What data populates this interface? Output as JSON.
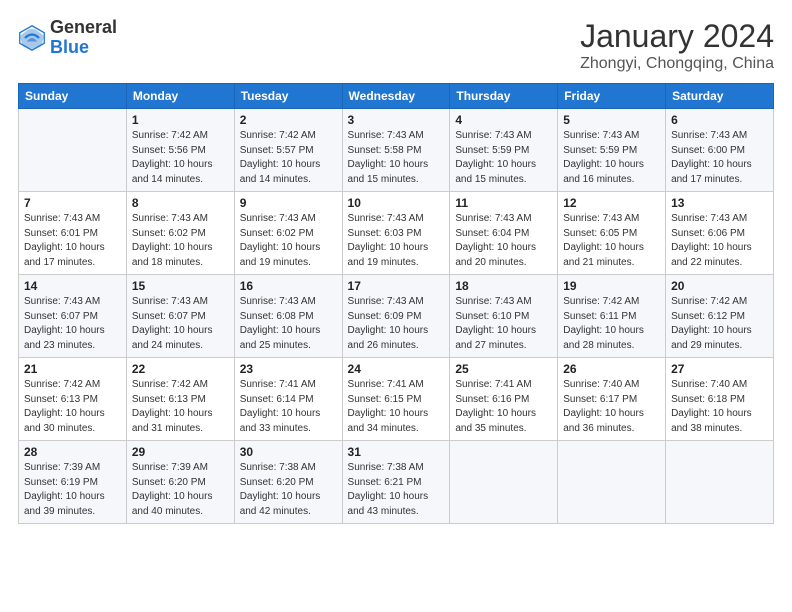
{
  "header": {
    "logo_general": "General",
    "logo_blue": "Blue",
    "month_title": "January 2024",
    "location": "Zhongyi, Chongqing, China"
  },
  "weekdays": [
    "Sunday",
    "Monday",
    "Tuesday",
    "Wednesday",
    "Thursday",
    "Friday",
    "Saturday"
  ],
  "rows": [
    [
      {
        "num": "",
        "info": ""
      },
      {
        "num": "1",
        "info": "Sunrise: 7:42 AM\nSunset: 5:56 PM\nDaylight: 10 hours\nand 14 minutes."
      },
      {
        "num": "2",
        "info": "Sunrise: 7:42 AM\nSunset: 5:57 PM\nDaylight: 10 hours\nand 14 minutes."
      },
      {
        "num": "3",
        "info": "Sunrise: 7:43 AM\nSunset: 5:58 PM\nDaylight: 10 hours\nand 15 minutes."
      },
      {
        "num": "4",
        "info": "Sunrise: 7:43 AM\nSunset: 5:59 PM\nDaylight: 10 hours\nand 15 minutes."
      },
      {
        "num": "5",
        "info": "Sunrise: 7:43 AM\nSunset: 5:59 PM\nDaylight: 10 hours\nand 16 minutes."
      },
      {
        "num": "6",
        "info": "Sunrise: 7:43 AM\nSunset: 6:00 PM\nDaylight: 10 hours\nand 17 minutes."
      }
    ],
    [
      {
        "num": "7",
        "info": "Sunrise: 7:43 AM\nSunset: 6:01 PM\nDaylight: 10 hours\nand 17 minutes."
      },
      {
        "num": "8",
        "info": "Sunrise: 7:43 AM\nSunset: 6:02 PM\nDaylight: 10 hours\nand 18 minutes."
      },
      {
        "num": "9",
        "info": "Sunrise: 7:43 AM\nSunset: 6:02 PM\nDaylight: 10 hours\nand 19 minutes."
      },
      {
        "num": "10",
        "info": "Sunrise: 7:43 AM\nSunset: 6:03 PM\nDaylight: 10 hours\nand 19 minutes."
      },
      {
        "num": "11",
        "info": "Sunrise: 7:43 AM\nSunset: 6:04 PM\nDaylight: 10 hours\nand 20 minutes."
      },
      {
        "num": "12",
        "info": "Sunrise: 7:43 AM\nSunset: 6:05 PM\nDaylight: 10 hours\nand 21 minutes."
      },
      {
        "num": "13",
        "info": "Sunrise: 7:43 AM\nSunset: 6:06 PM\nDaylight: 10 hours\nand 22 minutes."
      }
    ],
    [
      {
        "num": "14",
        "info": "Sunrise: 7:43 AM\nSunset: 6:07 PM\nDaylight: 10 hours\nand 23 minutes."
      },
      {
        "num": "15",
        "info": "Sunrise: 7:43 AM\nSunset: 6:07 PM\nDaylight: 10 hours\nand 24 minutes."
      },
      {
        "num": "16",
        "info": "Sunrise: 7:43 AM\nSunset: 6:08 PM\nDaylight: 10 hours\nand 25 minutes."
      },
      {
        "num": "17",
        "info": "Sunrise: 7:43 AM\nSunset: 6:09 PM\nDaylight: 10 hours\nand 26 minutes."
      },
      {
        "num": "18",
        "info": "Sunrise: 7:43 AM\nSunset: 6:10 PM\nDaylight: 10 hours\nand 27 minutes."
      },
      {
        "num": "19",
        "info": "Sunrise: 7:42 AM\nSunset: 6:11 PM\nDaylight: 10 hours\nand 28 minutes."
      },
      {
        "num": "20",
        "info": "Sunrise: 7:42 AM\nSunset: 6:12 PM\nDaylight: 10 hours\nand 29 minutes."
      }
    ],
    [
      {
        "num": "21",
        "info": "Sunrise: 7:42 AM\nSunset: 6:13 PM\nDaylight: 10 hours\nand 30 minutes."
      },
      {
        "num": "22",
        "info": "Sunrise: 7:42 AM\nSunset: 6:13 PM\nDaylight: 10 hours\nand 31 minutes."
      },
      {
        "num": "23",
        "info": "Sunrise: 7:41 AM\nSunset: 6:14 PM\nDaylight: 10 hours\nand 33 minutes."
      },
      {
        "num": "24",
        "info": "Sunrise: 7:41 AM\nSunset: 6:15 PM\nDaylight: 10 hours\nand 34 minutes."
      },
      {
        "num": "25",
        "info": "Sunrise: 7:41 AM\nSunset: 6:16 PM\nDaylight: 10 hours\nand 35 minutes."
      },
      {
        "num": "26",
        "info": "Sunrise: 7:40 AM\nSunset: 6:17 PM\nDaylight: 10 hours\nand 36 minutes."
      },
      {
        "num": "27",
        "info": "Sunrise: 7:40 AM\nSunset: 6:18 PM\nDaylight: 10 hours\nand 38 minutes."
      }
    ],
    [
      {
        "num": "28",
        "info": "Sunrise: 7:39 AM\nSunset: 6:19 PM\nDaylight: 10 hours\nand 39 minutes."
      },
      {
        "num": "29",
        "info": "Sunrise: 7:39 AM\nSunset: 6:20 PM\nDaylight: 10 hours\nand 40 minutes."
      },
      {
        "num": "30",
        "info": "Sunrise: 7:38 AM\nSunset: 6:20 PM\nDaylight: 10 hours\nand 42 minutes."
      },
      {
        "num": "31",
        "info": "Sunrise: 7:38 AM\nSunset: 6:21 PM\nDaylight: 10 hours\nand 43 minutes."
      },
      {
        "num": "",
        "info": ""
      },
      {
        "num": "",
        "info": ""
      },
      {
        "num": "",
        "info": ""
      }
    ]
  ]
}
